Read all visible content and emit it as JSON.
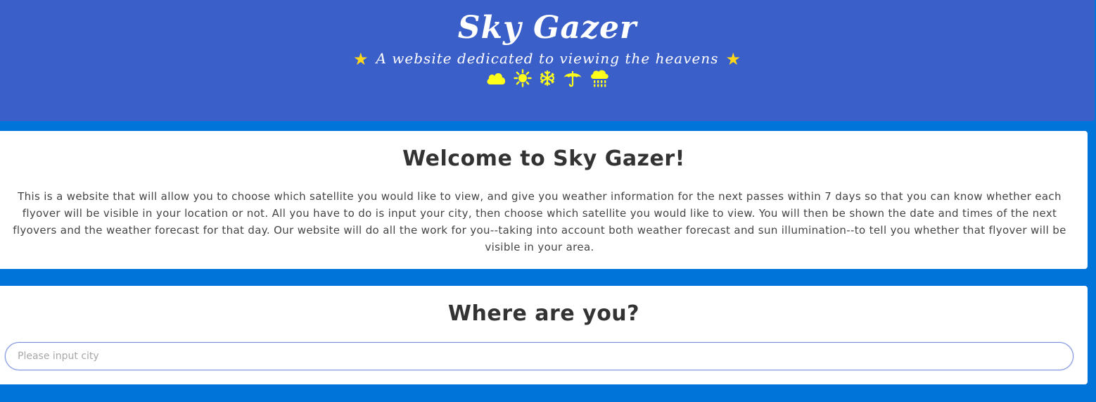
{
  "header": {
    "title": "Sky Gazer",
    "tagline": "A website dedicated to viewing the heavens",
    "star_glyph": "★",
    "decor_icons": [
      "cloud-icon",
      "sun-icon",
      "snowflake-icon",
      "umbrella-icon",
      "rain-cloud-icon"
    ]
  },
  "welcome": {
    "heading": "Welcome to Sky Gazer!",
    "body": "This is a website that will allow you to choose which satellite you would like to view, and give you weather information for the next passes within 7 days so that you can know whether each flyover will be visible in your location or not. All you have to do is input your city, then choose which satellite you would like to view. You will then be shown the date and times of the next flyovers and the weather forecast for that day. Our website will do all the work for you--taking into account both weather forecast and sun illumination--to tell you whether that flyover will be visible in your area."
  },
  "location": {
    "heading": "Where are you?",
    "input": {
      "value": "",
      "placeholder": "Please input city"
    }
  },
  "colors": {
    "header_bg": "#3b5fc8",
    "page_bg": "#0174d9",
    "card_bg": "#ffffff",
    "accent_yellow": "#ffff1a",
    "star_yellow": "#ffd71a",
    "heading_text": "#333333"
  }
}
